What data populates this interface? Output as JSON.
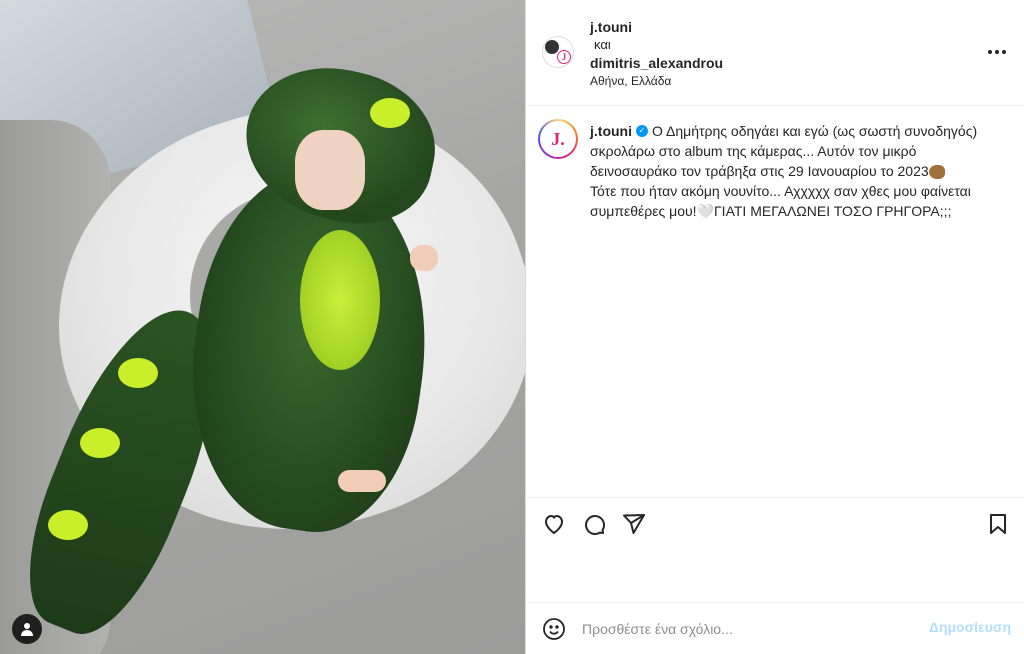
{
  "header": {
    "username1": "j.touni",
    "connector": "και",
    "username2": "dimitris_alexandrou",
    "location": "Αθήνα, Ελλάδα",
    "more_icon": "more-horizontal-icon"
  },
  "caption": {
    "username": "j.touni",
    "verified_icon": "verified-badge-icon",
    "line1": "Ο Δημήτρης οδηγάει και εγώ (ως σωστή συνοδηγός) σκρολάρω στο album της κάμερας... Αυτόν τον μικρό δεινοσαυράκο τον τράβηξα στις 29 Ιανουαρίου το 2023",
    "line2": "Τότε που ήταν ακόμη νουνίτο... Αχχχχχ σαν χθες μου φαίνεται συμπεθέρες μου!🤍ΓΙΑΤΙ ΜΕΓΑΛΩΝΕΙ ΤΟΣΟ ΓΡΗΓΟΡΑ;;;",
    "avatar_letter": "J."
  },
  "actions": {
    "like_icon": "heart-icon",
    "comment_icon": "comment-icon",
    "share_icon": "send-icon",
    "save_icon": "bookmark-icon"
  },
  "comment": {
    "placeholder": "Προσθέστε ένα σχόλιο...",
    "post_label": "Δημοσίευση",
    "emoji_icon": "emoji-smile-icon"
  },
  "photo": {
    "user_tag_icon": "user-tag-icon"
  },
  "colors": {
    "verified": "#0095f6",
    "post_disabled": "#b2dffc",
    "border": "#dbdbdb"
  }
}
